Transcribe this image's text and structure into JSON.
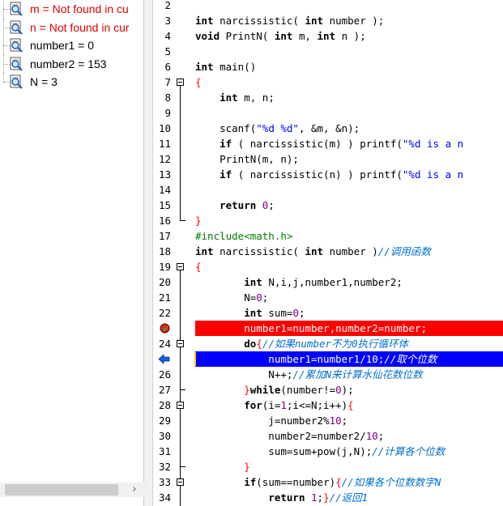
{
  "watch": {
    "items": [
      {
        "label": "m = Not found in cu",
        "error": true
      },
      {
        "label": "n = Not found in cur",
        "error": true
      },
      {
        "label": "number1 = 0",
        "error": false
      },
      {
        "label": "number2 = 153",
        "error": false
      },
      {
        "label": "N = 3",
        "error": false
      }
    ],
    "scroll_right": "›"
  },
  "editor": {
    "first_line": 2,
    "breakpoint_line": 23,
    "current_line": 25,
    "lines": [
      {
        "n": "2",
        "segs": []
      },
      {
        "n": "3",
        "segs": [
          [
            "kw",
            "int"
          ],
          [
            "t",
            " narcissistic( "
          ],
          [
            "kw",
            "int"
          ],
          [
            "t",
            " number );"
          ]
        ]
      },
      {
        "n": "4",
        "segs": [
          [
            "kw",
            "void"
          ],
          [
            "t",
            " PrintN( "
          ],
          [
            "kw",
            "int"
          ],
          [
            "t",
            " m, "
          ],
          [
            "kw",
            "int"
          ],
          [
            "t",
            " n );"
          ]
        ]
      },
      {
        "n": "5",
        "segs": []
      },
      {
        "n": "6",
        "segs": [
          [
            "kw",
            "int"
          ],
          [
            "t",
            " main()"
          ]
        ]
      },
      {
        "n": "7",
        "segs": [
          [
            "op",
            "{"
          ]
        ]
      },
      {
        "n": "8",
        "segs": [
          [
            "t",
            "    "
          ],
          [
            "kw",
            "int"
          ],
          [
            "t",
            " m, n;"
          ]
        ]
      },
      {
        "n": "9",
        "segs": []
      },
      {
        "n": "10",
        "segs": [
          [
            "t",
            "    scanf("
          ],
          [
            "str",
            "\"%d %d\""
          ],
          [
            "t",
            ", &m, &n);"
          ]
        ]
      },
      {
        "n": "11",
        "segs": [
          [
            "t",
            "    "
          ],
          [
            "kw",
            "if"
          ],
          [
            "t",
            " ( narcissistic(m) ) printf("
          ],
          [
            "str",
            "\"%d is a n"
          ]
        ]
      },
      {
        "n": "12",
        "segs": [
          [
            "t",
            "    PrintN(m, n);"
          ]
        ]
      },
      {
        "n": "13",
        "segs": [
          [
            "t",
            "    "
          ],
          [
            "kw",
            "if"
          ],
          [
            "t",
            " ( narcissistic(n) ) printf("
          ],
          [
            "str",
            "\"%d is a n"
          ]
        ]
      },
      {
        "n": "14",
        "segs": []
      },
      {
        "n": "15",
        "segs": [
          [
            "t",
            "    "
          ],
          [
            "kw",
            "return"
          ],
          [
            "t",
            " "
          ],
          [
            "num",
            "0"
          ],
          [
            "t",
            ";"
          ]
        ]
      },
      {
        "n": "16",
        "segs": [
          [
            "op",
            "}"
          ]
        ]
      },
      {
        "n": "17",
        "segs": [
          [
            "pp",
            "#include<math.h>"
          ]
        ]
      },
      {
        "n": "18",
        "segs": [
          [
            "kw",
            "int"
          ],
          [
            "t",
            " narcissistic( "
          ],
          [
            "kw",
            "int"
          ],
          [
            "t",
            " number )"
          ],
          [
            "cm",
            "//调用函数"
          ]
        ]
      },
      {
        "n": "19",
        "segs": [
          [
            "op",
            "{"
          ]
        ]
      },
      {
        "n": "20",
        "segs": [
          [
            "t",
            "        "
          ],
          [
            "kw",
            "int"
          ],
          [
            "t",
            " N,i,j,number1,number2;"
          ]
        ]
      },
      {
        "n": "21",
        "segs": [
          [
            "t",
            "        N="
          ],
          [
            "num",
            "0"
          ],
          [
            "t",
            ";"
          ]
        ]
      },
      {
        "n": "22",
        "segs": [
          [
            "t",
            "        "
          ],
          [
            "kw",
            "int"
          ],
          [
            "t",
            " sum="
          ],
          [
            "num",
            "0"
          ],
          [
            "t",
            ";"
          ]
        ]
      },
      {
        "n": "23",
        "segs": [
          [
            "t",
            "        number1=number,number2=number;"
          ]
        ]
      },
      {
        "n": "24",
        "segs": [
          [
            "t",
            "        "
          ],
          [
            "kw",
            "do"
          ],
          [
            "op",
            "{"
          ],
          [
            "cm",
            "//如果number不为0执行循环体"
          ]
        ]
      },
      {
        "n": "25",
        "segs": [
          [
            "t",
            "            number1=number1/"
          ],
          [
            "num",
            "10"
          ],
          [
            "t",
            ";"
          ],
          [
            "cm",
            "//取个位数"
          ]
        ]
      },
      {
        "n": "26",
        "segs": [
          [
            "t",
            "            N++;"
          ],
          [
            "cm",
            "//累加N来计算水仙花数位数"
          ]
        ]
      },
      {
        "n": "27",
        "segs": [
          [
            "t",
            "        "
          ],
          [
            "op",
            "}"
          ],
          [
            "kw",
            "while"
          ],
          [
            "t",
            "(number!="
          ],
          [
            "num",
            "0"
          ],
          [
            "t",
            ");"
          ]
        ]
      },
      {
        "n": "28",
        "segs": [
          [
            "t",
            "        "
          ],
          [
            "kw",
            "for"
          ],
          [
            "t",
            "(i="
          ],
          [
            "num",
            "1"
          ],
          [
            "t",
            ";i<=N;i++)"
          ],
          [
            "op",
            "{"
          ]
        ]
      },
      {
        "n": "29",
        "segs": [
          [
            "t",
            "            j=number2%"
          ],
          [
            "num",
            "10"
          ],
          [
            "t",
            ";"
          ]
        ]
      },
      {
        "n": "30",
        "segs": [
          [
            "t",
            "            number2=number2/"
          ],
          [
            "num",
            "10"
          ],
          [
            "t",
            ";"
          ]
        ]
      },
      {
        "n": "31",
        "segs": [
          [
            "t",
            "            sum=sum+pow(j,N);"
          ],
          [
            "cm",
            "//计算各个位数"
          ]
        ]
      },
      {
        "n": "32",
        "segs": [
          [
            "t",
            "        "
          ],
          [
            "op",
            "}"
          ]
        ]
      },
      {
        "n": "33",
        "segs": [
          [
            "t",
            "        "
          ],
          [
            "kw",
            "if"
          ],
          [
            "t",
            "(sum==number)"
          ],
          [
            "op",
            "{"
          ],
          [
            "cm",
            "//如果各个位数数字N"
          ]
        ]
      },
      {
        "n": "34",
        "segs": [
          [
            "t",
            "            "
          ],
          [
            "kw",
            "return"
          ],
          [
            "t",
            " "
          ],
          [
            "num",
            "1"
          ],
          [
            "t",
            ";"
          ],
          [
            "op",
            "}"
          ],
          [
            "cm",
            "//返回1"
          ]
        ]
      }
    ]
  },
  "icons": {
    "watch_item": "watch-magnifier-icon",
    "breakpoint": "breakpoint-icon",
    "current_line": "current-line-arrow-icon",
    "fold": "fold-minus-icon"
  },
  "colors": {
    "error_text": "#e00000",
    "breakpoint_line": "#ff0000",
    "current_line": "#0000ff",
    "keyword": "#000000",
    "number": "#800080",
    "string": "#0000ff",
    "comment": "#0070d0",
    "preprocessor": "#008000"
  }
}
